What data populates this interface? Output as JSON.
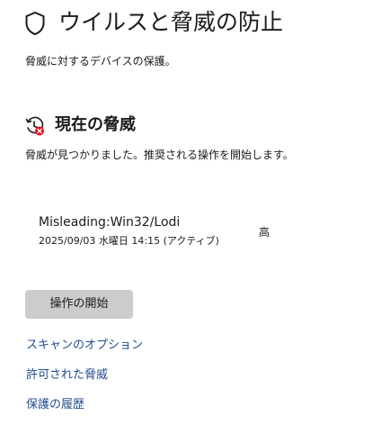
{
  "header": {
    "title": "ウイルスと脅威の防止",
    "subtitle": "脅威に対するデバイスの保護。",
    "icon": "shield-icon"
  },
  "current_threats": {
    "title": "現在の脅威",
    "icon": "threat-history-icon",
    "description": "脅威が見つかりました。推奨される操作を開始します。",
    "items": [
      {
        "name": "Misleading:Win32/Lodi",
        "detail": "2025/09/03 水曜日 14:15 (アクティブ)",
        "severity": "高"
      }
    ],
    "action_button": "操作の開始"
  },
  "links": {
    "scan_options": "スキャンのオプション",
    "allowed_threats": "許可された脅威",
    "protection_history": "保護の履歴"
  },
  "colors": {
    "link": "#1f4b8e",
    "button_bg": "#cccccc",
    "threat_badge": "#e81123",
    "text": "#1b1b1b"
  }
}
